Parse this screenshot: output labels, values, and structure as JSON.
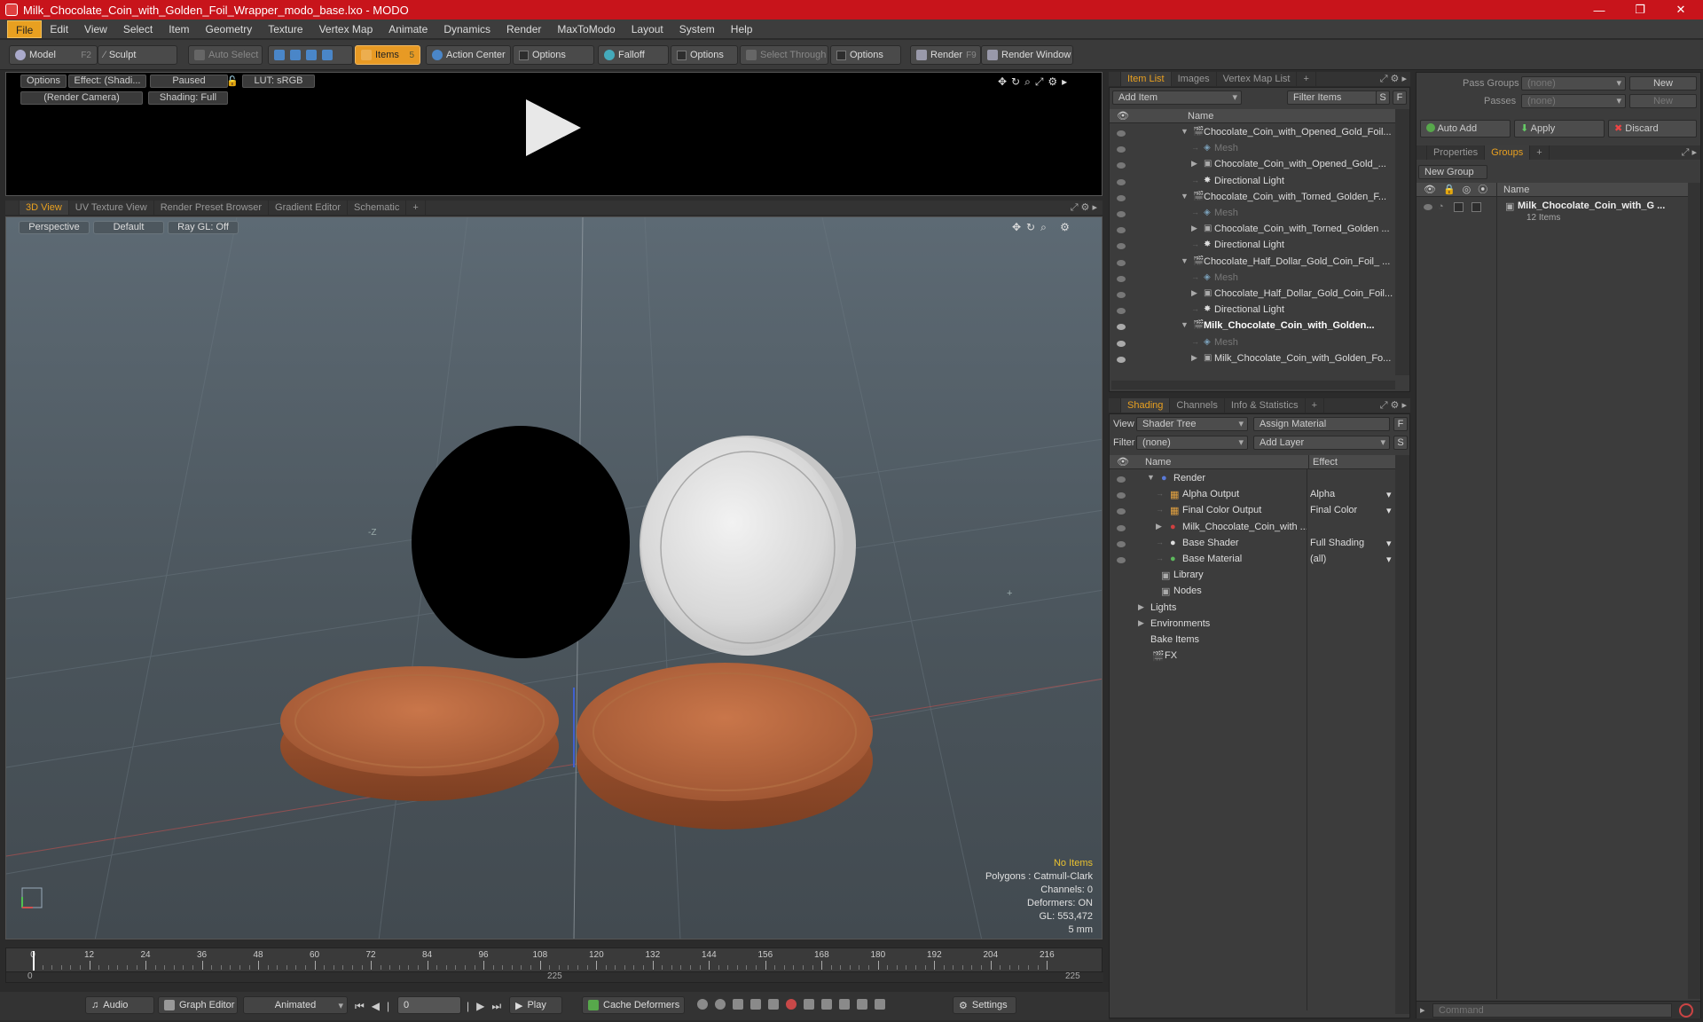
{
  "window": {
    "title": "Milk_Chocolate_Coin_with_Golden_Foil_Wrapper_modo_base.lxo - MODO",
    "minimize": "—",
    "maximize": "❐",
    "close": "✕"
  },
  "menu": [
    "File",
    "Edit",
    "View",
    "Select",
    "Item",
    "Geometry",
    "Texture",
    "Vertex Map",
    "Animate",
    "Dynamics",
    "Render",
    "MaxToModo",
    "Layout",
    "System",
    "Help"
  ],
  "toolbar": {
    "model": "Model",
    "model_key": "F2",
    "sculpt": "Sculpt",
    "auto_select": "Auto Select",
    "items": "Items",
    "items_key": "5",
    "action_center": "Action Center",
    "options1": "Options",
    "falloff": "Falloff",
    "options2": "Options",
    "select_through": "Select Through",
    "options3": "Options",
    "render": "Render",
    "render_key": "F9",
    "render_window": "Render Window"
  },
  "preview": {
    "options": "Options",
    "effect": "Effect: (Shadi...",
    "paused": "Paused",
    "lut": "LUT: sRGB",
    "camera": "(Render Camera)",
    "shading": "Shading: Full"
  },
  "viewport_tabs": [
    "3D View",
    "UV Texture View",
    "Render Preset Browser",
    "Gradient Editor",
    "Schematic",
    "+"
  ],
  "viewport": {
    "perspective": "Perspective",
    "default": "Default",
    "raygl": "Ray GL: Off",
    "axis_neg_z": "-Z",
    "axis_plus": "+"
  },
  "stats": {
    "items": "No Items",
    "polygons": "Polygons : Catmull-Clark",
    "channels": "Channels: 0",
    "deformers": "Deformers: ON",
    "gl": "GL: 553,472",
    "unit": "5 mm"
  },
  "colors": {
    "stat_items": "#e8c030",
    "accent": "#e8a020",
    "title_red": "#c8141b"
  },
  "timeline": {
    "ticks": [
      "0",
      "12",
      "24",
      "36",
      "48",
      "60",
      "72",
      "84",
      "96",
      "108",
      "120",
      "132",
      "144",
      "156",
      "168",
      "180",
      "192",
      "204",
      "216"
    ],
    "bottom_left": "0",
    "bottom_mid": "225",
    "bottom_right": "225"
  },
  "bottombar": {
    "audio": "Audio",
    "graph_editor": "Graph Editor",
    "animated": "Animated",
    "frame": "0",
    "play": "Play",
    "cache": "Cache Deformers",
    "settings": "Settings"
  },
  "item_list": {
    "tabs": [
      "Item List",
      "Images",
      "Vertex Map List",
      "+"
    ],
    "add_item": "Add Item",
    "filter": "Filter Items",
    "s": "S",
    "f": "F",
    "col_name": "Name",
    "rows": [
      {
        "label": "Chocolate_Coin_with_Opened_Gold_Foil...",
        "indent": 0,
        "arrow": "▼",
        "kind": "scene"
      },
      {
        "label": "Mesh",
        "indent": 1,
        "arrow": "",
        "kind": "mesh"
      },
      {
        "label": "Chocolate_Coin_with_Opened_Gold_...",
        "indent": 1,
        "arrow": "▶",
        "kind": "group"
      },
      {
        "label": "Directional Light",
        "indent": 1,
        "arrow": "",
        "kind": "light"
      },
      {
        "label": "Chocolate_Coin_with_Torned_Golden_F...",
        "indent": 0,
        "arrow": "▼",
        "kind": "scene"
      },
      {
        "label": "Mesh",
        "indent": 1,
        "arrow": "",
        "kind": "mesh"
      },
      {
        "label": "Chocolate_Coin_with_Torned_Golden ...",
        "indent": 1,
        "arrow": "▶",
        "kind": "group"
      },
      {
        "label": "Directional Light",
        "indent": 1,
        "arrow": "",
        "kind": "light"
      },
      {
        "label": "Chocolate_Half_Dollar_Gold_Coin_Foil_ ...",
        "indent": 0,
        "arrow": "▼",
        "kind": "scene"
      },
      {
        "label": "Mesh",
        "indent": 1,
        "arrow": "",
        "kind": "mesh"
      },
      {
        "label": "Chocolate_Half_Dollar_Gold_Coin_Foil...",
        "indent": 1,
        "arrow": "▶",
        "kind": "group"
      },
      {
        "label": "Directional Light",
        "indent": 1,
        "arrow": "",
        "kind": "light"
      },
      {
        "label": "Milk_Chocolate_Coin_with_Golden...",
        "indent": 0,
        "arrow": "▼",
        "kind": "scene-bold"
      },
      {
        "label": "Mesh",
        "indent": 1,
        "arrow": "",
        "kind": "mesh"
      },
      {
        "label": "Milk_Chocolate_Coin_with_Golden_Fo...",
        "indent": 1,
        "arrow": "▶",
        "kind": "group"
      }
    ]
  },
  "shading": {
    "tabs": [
      "Shading",
      "Channels",
      "Info & Statistics",
      "+"
    ],
    "view_label": "View",
    "view_value": "Shader Tree",
    "assign": "Assign Material",
    "f": "F",
    "filter_label": "Filter",
    "filter_value": "(none)",
    "add_layer": "Add Layer",
    "s": "S",
    "col_name": "Name",
    "col_effect": "Effect",
    "rows": [
      {
        "label": "Render",
        "effect": "",
        "indent": 0,
        "arrow": "▼"
      },
      {
        "label": "Alpha Output",
        "effect": "Alpha",
        "indent": 1,
        "arrow": ""
      },
      {
        "label": "Final Color Output",
        "effect": "Final Color",
        "indent": 1,
        "arrow": ""
      },
      {
        "label": "Milk_Chocolate_Coin_with ...",
        "effect": "",
        "indent": 1,
        "arrow": "▶"
      },
      {
        "label": "Base Shader",
        "effect": "Full Shading",
        "indent": 1,
        "arrow": ""
      },
      {
        "label": "Base Material",
        "effect": "(all)",
        "indent": 1,
        "arrow": ""
      },
      {
        "label": "Library",
        "effect": "",
        "indent": 0,
        "arrow": ""
      },
      {
        "label": "Nodes",
        "effect": "",
        "indent": 0,
        "arrow": ""
      },
      {
        "label": "Lights",
        "effect": "",
        "indent": -1,
        "arrow": "▶"
      },
      {
        "label": "Environments",
        "effect": "",
        "indent": -1,
        "arrow": "▶"
      },
      {
        "label": "Bake Items",
        "effect": "",
        "indent": -1,
        "arrow": ""
      },
      {
        "label": "FX",
        "effect": "",
        "indent": -1,
        "arrow": ""
      }
    ]
  },
  "groups": {
    "pass_groups": "Pass Groups",
    "pass_groups_value": "(none)",
    "new": "New",
    "passes": "Passes",
    "passes_value": "(none)",
    "new2": "New",
    "auto_add": "Auto Add",
    "apply": "Apply",
    "discard": "Discard",
    "tabs": [
      "Properties",
      "Groups",
      "+"
    ],
    "new_group": "New Group",
    "col_name": "Name",
    "group_name": "Milk_Chocolate_Coin_with_G ...",
    "group_count": "12 Items",
    "command_placeholder": "Command"
  }
}
